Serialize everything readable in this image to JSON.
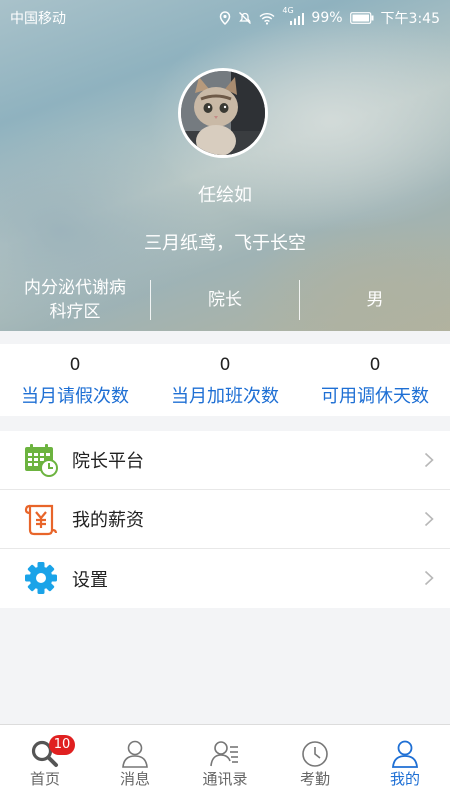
{
  "status_bar": {
    "carrier": "中国移动",
    "network": "4G",
    "battery": "99%",
    "time": "下午3:45"
  },
  "profile": {
    "name": "任绘如",
    "signature": "三月纸鸢，飞于长空",
    "department": "内分泌代谢病科疗区",
    "position": "院长",
    "gender": "男"
  },
  "stats": [
    {
      "value": "0",
      "label": "当月请假次数"
    },
    {
      "value": "0",
      "label": "当月加班次数"
    },
    {
      "value": "0",
      "label": "可用调休天数"
    }
  ],
  "menu": [
    {
      "label": "院长平台",
      "icon": "calendar-clock-icon",
      "color": "#6cb33f"
    },
    {
      "label": "我的薪资",
      "icon": "salary-scroll-icon",
      "color": "#e8652a"
    },
    {
      "label": "设置",
      "icon": "gear-icon",
      "color": "#1aa3e8"
    }
  ],
  "tabbar": {
    "tabs": [
      {
        "label": "首页",
        "icon": "search-home-icon"
      },
      {
        "label": "消息",
        "icon": "person-icon"
      },
      {
        "label": "通讯录",
        "icon": "contacts-icon"
      },
      {
        "label": "考勤",
        "icon": "clock-icon"
      },
      {
        "label": "我的",
        "icon": "person-icon"
      }
    ],
    "badge": "10",
    "active": "我的",
    "active_color": "#1e6fd4"
  }
}
